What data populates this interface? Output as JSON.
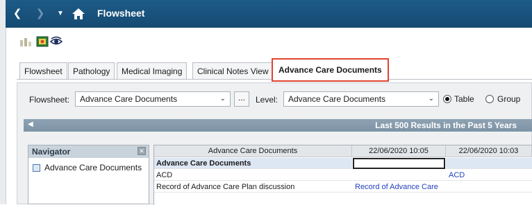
{
  "window": {
    "title": "Flowsheet",
    "back_icon": "chevron-left",
    "forward_icon": "chevron-right",
    "dropdown_icon": "caret-down",
    "home_icon": "home",
    "accent_color": "#1d5b88"
  },
  "toolbar": {
    "icons": [
      "grid-icon",
      "image-icon",
      "eye-icon"
    ]
  },
  "tabs": [
    {
      "label": "Flowsheet",
      "active": false
    },
    {
      "label": "Pathology",
      "active": false
    },
    {
      "label": "Medical Imaging",
      "active": false
    },
    {
      "label": "Clinical Notes View",
      "active": false
    },
    {
      "label": "Advance Care Documents",
      "active": true
    }
  ],
  "filters": {
    "flowsheet_label": "Flowsheet:",
    "flowsheet_value": "Advance Care Documents",
    "more_label": "...",
    "level_label": "Level:",
    "level_value": "Advance Care Documents",
    "view_options": [
      {
        "label": "Table",
        "selected": true
      },
      {
        "label": "Group",
        "selected": false
      }
    ]
  },
  "results_bar": {
    "text": "Last 500 Results in the Past  5 Years"
  },
  "navigator": {
    "title": "Navigator",
    "items": [
      "Advance Care Documents"
    ]
  },
  "grid": {
    "columns": [
      "Advance Care Documents",
      "22/06/2020 10:05",
      "22/06/2020 10:03"
    ],
    "rows": [
      {
        "label": "Advance Care Documents",
        "cells": [
          "",
          ""
        ],
        "header": true
      },
      {
        "label": "ACD",
        "cells": [
          "",
          "ACD"
        ]
      },
      {
        "label": "Record of Advance Care Plan discussion",
        "cells": [
          "Record of Advance Care",
          ""
        ]
      }
    ]
  }
}
